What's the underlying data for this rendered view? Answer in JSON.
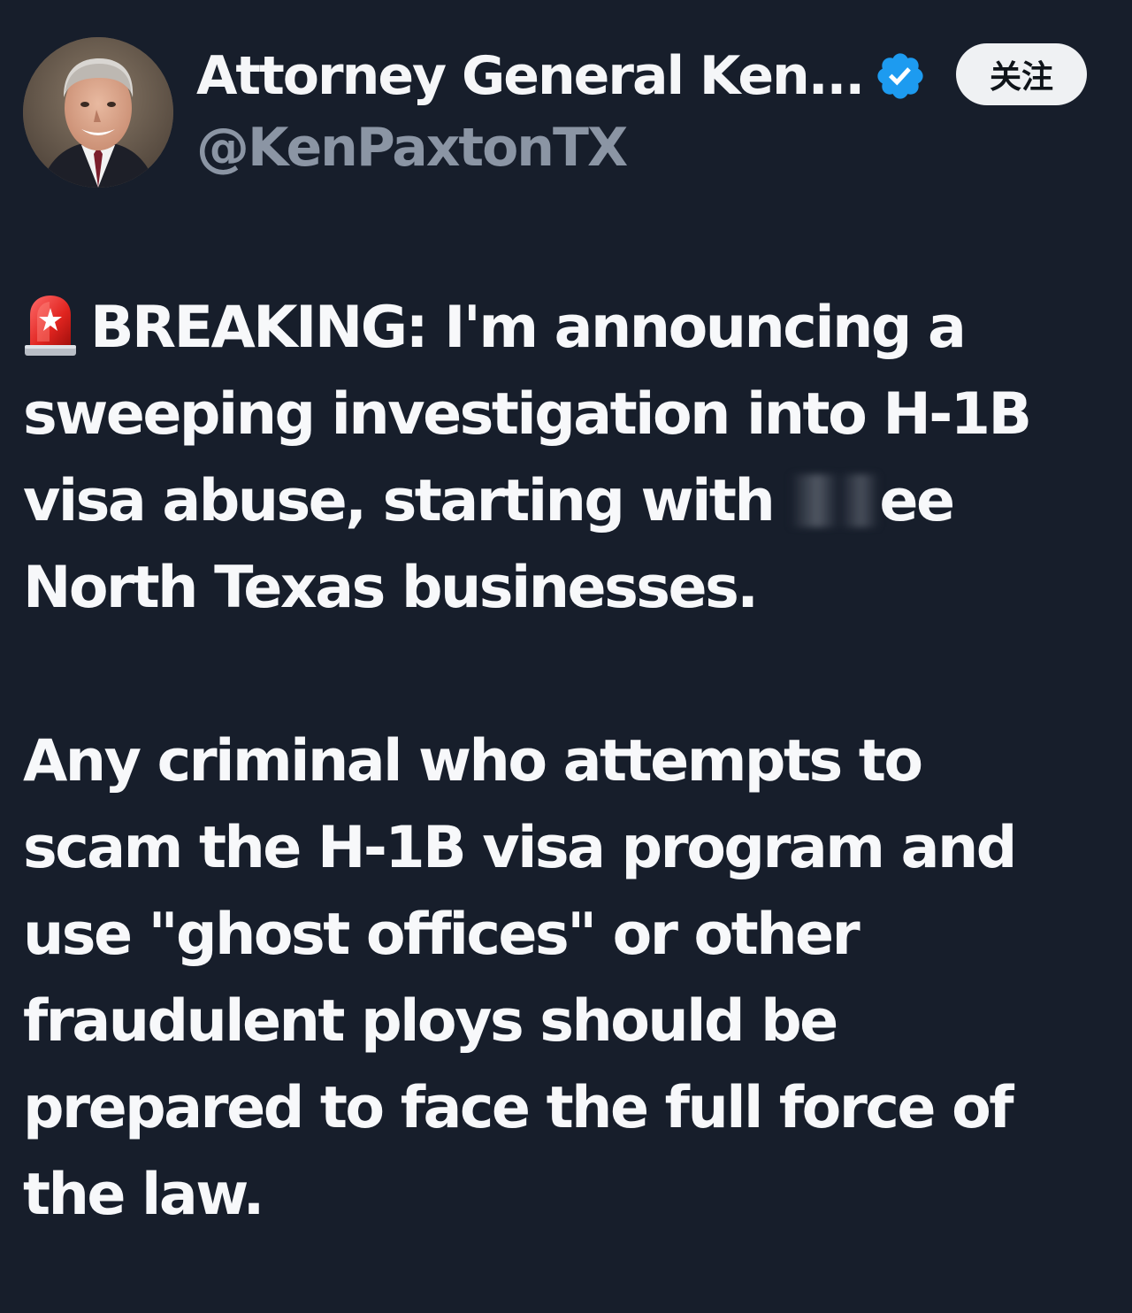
{
  "profile": {
    "display_name": "Attorney General Ken...",
    "handle": "@KenPaxtonTX",
    "avatar_icon": "profile-photo",
    "verified_icon": "verified-badge-icon",
    "verified_color": "#1d9bf0"
  },
  "follow_button": {
    "label": "关注"
  },
  "tweet": {
    "siren_icon": "police-siren-emoji",
    "paragraph1": {
      "line1": "BREAKING: I'm announcing a",
      "line2": "sweeping investigation into H-1B",
      "line3_before": "visa abuse, starting with ",
      "line3_after": "ee",
      "line4": "North Texas businesses."
    },
    "paragraph2": {
      "line1": "Any criminal who attempts to",
      "line2": "scam the H-1B visa program and",
      "line3": "use \"ghost offices\" or other",
      "line4": "fraudulent ploys should be",
      "line5": "prepared to face the full force of",
      "line6": "the law."
    }
  },
  "colors": {
    "background": "#171e2b",
    "text": "#f7f8fa",
    "handle": "#8b95a4",
    "button_bg": "#eff1f3"
  }
}
